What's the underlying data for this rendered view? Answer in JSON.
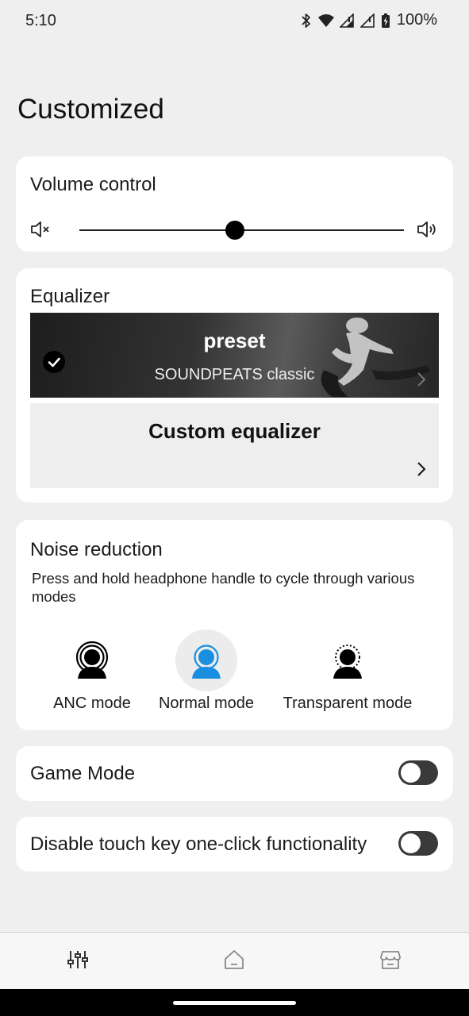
{
  "status_bar": {
    "time": "5:10",
    "battery": "100%"
  },
  "page": {
    "title": "Customized"
  },
  "volume": {
    "title": "Volume control",
    "level_fraction": 0.48
  },
  "equalizer": {
    "title": "Equalizer",
    "preset": {
      "title": "preset",
      "name": "SOUNDPEATS classic",
      "selected": true
    },
    "custom": {
      "title": "Custom equalizer"
    }
  },
  "noise": {
    "title": "Noise reduction",
    "description": "Press and hold headphone handle to cycle through various modes",
    "modes": [
      {
        "label": "ANC mode",
        "icon": "anc-mode-icon",
        "selected": false
      },
      {
        "label": "Normal mode",
        "icon": "normal-mode-icon",
        "selected": true
      },
      {
        "label": "Transparent mode",
        "icon": "transparent-mode-icon",
        "selected": false
      }
    ],
    "accent_color": "#1a8fe0"
  },
  "game_mode": {
    "label": "Game Mode",
    "enabled": false
  },
  "touch_key": {
    "label": "Disable touch key one-click functionality",
    "enabled": false
  },
  "bottom_nav": {
    "items": [
      "equalizer-sliders-icon",
      "home-icon",
      "store-icon"
    ]
  }
}
